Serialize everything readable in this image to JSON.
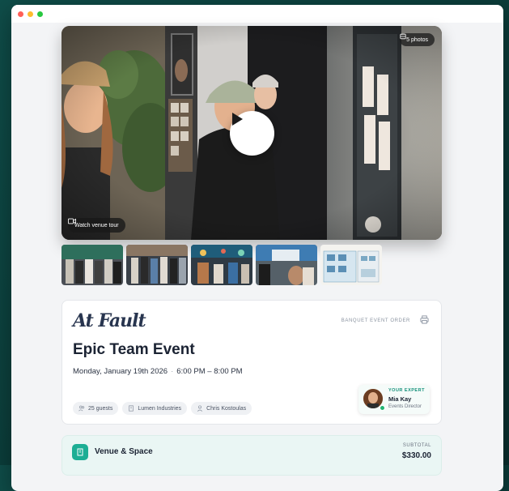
{
  "hero": {
    "photos_label": "5 photos",
    "tour_label": "Watch venue tour"
  },
  "thumbnails": [
    "thumb-1",
    "thumb-2",
    "thumb-3",
    "thumb-4",
    "thumb-5"
  ],
  "event": {
    "brand": "At Fault",
    "order_label": "BANQUET EVENT ORDER",
    "title": "Epic Team Event",
    "date": "Monday, January 19th 2026",
    "time": "6:00 PM – 8:00 PM",
    "guests": "25 guests",
    "company": "Lumen Industries",
    "contact": "Chris Kostoulas"
  },
  "expert": {
    "label": "YOUR EXPERT",
    "name": "Mia Kay",
    "role": "Events Director"
  },
  "venue": {
    "title": "Venue & Space",
    "subtotal_label": "SUBTOTAL",
    "subtotal": "$330.00"
  },
  "colors": {
    "accent": "#1cae94",
    "brand_text": "#28354f",
    "background": "#0f4d49"
  }
}
